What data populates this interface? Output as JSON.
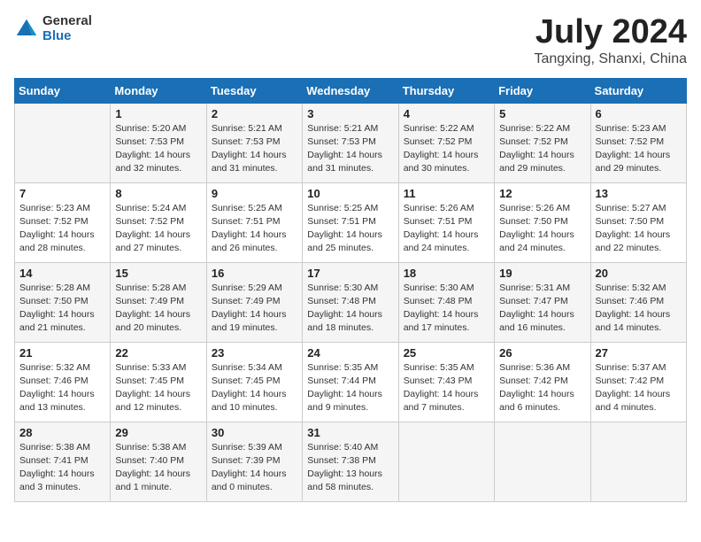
{
  "logo": {
    "general": "General",
    "blue": "Blue"
  },
  "title": {
    "month": "July 2024",
    "location": "Tangxing, Shanxi, China"
  },
  "days_of_week": [
    "Sunday",
    "Monday",
    "Tuesday",
    "Wednesday",
    "Thursday",
    "Friday",
    "Saturday"
  ],
  "weeks": [
    [
      {
        "day": "",
        "info": ""
      },
      {
        "day": "1",
        "info": "Sunrise: 5:20 AM\nSunset: 7:53 PM\nDaylight: 14 hours\nand 32 minutes."
      },
      {
        "day": "2",
        "info": "Sunrise: 5:21 AM\nSunset: 7:53 PM\nDaylight: 14 hours\nand 31 minutes."
      },
      {
        "day": "3",
        "info": "Sunrise: 5:21 AM\nSunset: 7:53 PM\nDaylight: 14 hours\nand 31 minutes."
      },
      {
        "day": "4",
        "info": "Sunrise: 5:22 AM\nSunset: 7:52 PM\nDaylight: 14 hours\nand 30 minutes."
      },
      {
        "day": "5",
        "info": "Sunrise: 5:22 AM\nSunset: 7:52 PM\nDaylight: 14 hours\nand 29 minutes."
      },
      {
        "day": "6",
        "info": "Sunrise: 5:23 AM\nSunset: 7:52 PM\nDaylight: 14 hours\nand 29 minutes."
      }
    ],
    [
      {
        "day": "7",
        "info": "Sunrise: 5:23 AM\nSunset: 7:52 PM\nDaylight: 14 hours\nand 28 minutes."
      },
      {
        "day": "8",
        "info": "Sunrise: 5:24 AM\nSunset: 7:52 PM\nDaylight: 14 hours\nand 27 minutes."
      },
      {
        "day": "9",
        "info": "Sunrise: 5:25 AM\nSunset: 7:51 PM\nDaylight: 14 hours\nand 26 minutes."
      },
      {
        "day": "10",
        "info": "Sunrise: 5:25 AM\nSunset: 7:51 PM\nDaylight: 14 hours\nand 25 minutes."
      },
      {
        "day": "11",
        "info": "Sunrise: 5:26 AM\nSunset: 7:51 PM\nDaylight: 14 hours\nand 24 minutes."
      },
      {
        "day": "12",
        "info": "Sunrise: 5:26 AM\nSunset: 7:50 PM\nDaylight: 14 hours\nand 24 minutes."
      },
      {
        "day": "13",
        "info": "Sunrise: 5:27 AM\nSunset: 7:50 PM\nDaylight: 14 hours\nand 22 minutes."
      }
    ],
    [
      {
        "day": "14",
        "info": "Sunrise: 5:28 AM\nSunset: 7:50 PM\nDaylight: 14 hours\nand 21 minutes."
      },
      {
        "day": "15",
        "info": "Sunrise: 5:28 AM\nSunset: 7:49 PM\nDaylight: 14 hours\nand 20 minutes."
      },
      {
        "day": "16",
        "info": "Sunrise: 5:29 AM\nSunset: 7:49 PM\nDaylight: 14 hours\nand 19 minutes."
      },
      {
        "day": "17",
        "info": "Sunrise: 5:30 AM\nSunset: 7:48 PM\nDaylight: 14 hours\nand 18 minutes."
      },
      {
        "day": "18",
        "info": "Sunrise: 5:30 AM\nSunset: 7:48 PM\nDaylight: 14 hours\nand 17 minutes."
      },
      {
        "day": "19",
        "info": "Sunrise: 5:31 AM\nSunset: 7:47 PM\nDaylight: 14 hours\nand 16 minutes."
      },
      {
        "day": "20",
        "info": "Sunrise: 5:32 AM\nSunset: 7:46 PM\nDaylight: 14 hours\nand 14 minutes."
      }
    ],
    [
      {
        "day": "21",
        "info": "Sunrise: 5:32 AM\nSunset: 7:46 PM\nDaylight: 14 hours\nand 13 minutes."
      },
      {
        "day": "22",
        "info": "Sunrise: 5:33 AM\nSunset: 7:45 PM\nDaylight: 14 hours\nand 12 minutes."
      },
      {
        "day": "23",
        "info": "Sunrise: 5:34 AM\nSunset: 7:45 PM\nDaylight: 14 hours\nand 10 minutes."
      },
      {
        "day": "24",
        "info": "Sunrise: 5:35 AM\nSunset: 7:44 PM\nDaylight: 14 hours\nand 9 minutes."
      },
      {
        "day": "25",
        "info": "Sunrise: 5:35 AM\nSunset: 7:43 PM\nDaylight: 14 hours\nand 7 minutes."
      },
      {
        "day": "26",
        "info": "Sunrise: 5:36 AM\nSunset: 7:42 PM\nDaylight: 14 hours\nand 6 minutes."
      },
      {
        "day": "27",
        "info": "Sunrise: 5:37 AM\nSunset: 7:42 PM\nDaylight: 14 hours\nand 4 minutes."
      }
    ],
    [
      {
        "day": "28",
        "info": "Sunrise: 5:38 AM\nSunset: 7:41 PM\nDaylight: 14 hours\nand 3 minutes."
      },
      {
        "day": "29",
        "info": "Sunrise: 5:38 AM\nSunset: 7:40 PM\nDaylight: 14 hours\nand 1 minute."
      },
      {
        "day": "30",
        "info": "Sunrise: 5:39 AM\nSunset: 7:39 PM\nDaylight: 14 hours\nand 0 minutes."
      },
      {
        "day": "31",
        "info": "Sunrise: 5:40 AM\nSunset: 7:38 PM\nDaylight: 13 hours\nand 58 minutes."
      },
      {
        "day": "",
        "info": ""
      },
      {
        "day": "",
        "info": ""
      },
      {
        "day": "",
        "info": ""
      }
    ]
  ]
}
